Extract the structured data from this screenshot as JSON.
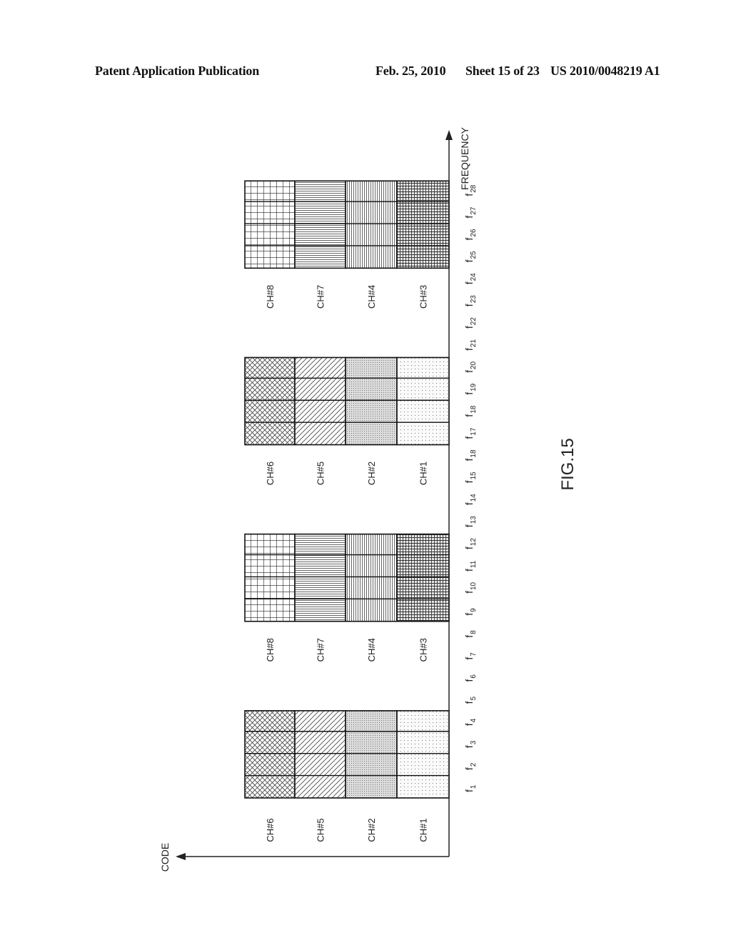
{
  "header": {
    "publication": "Patent Application Publication",
    "date": "Feb. 25, 2010",
    "sheet": "Sheet 15 of 23",
    "number": "US 2010/0048219 A1"
  },
  "figure": {
    "caption": "FIG.15",
    "axes": {
      "frequency_label": "FREQUENCY",
      "code_label": "CODE"
    },
    "frequency_labels": [
      {
        "main": "f",
        "sub": "1"
      },
      {
        "main": "f",
        "sub": "2"
      },
      {
        "main": "f",
        "sub": "3"
      },
      {
        "main": "f",
        "sub": "4"
      },
      {
        "main": "f",
        "sub": "5"
      },
      {
        "main": "f",
        "sub": "6"
      },
      {
        "main": "f",
        "sub": "7"
      },
      {
        "main": "f",
        "sub": "8"
      },
      {
        "main": "f",
        "sub": "9"
      },
      {
        "main": "f",
        "sub": "10"
      },
      {
        "main": "f",
        "sub": "11"
      },
      {
        "main": "f",
        "sub": "12"
      },
      {
        "main": "f",
        "sub": "13"
      },
      {
        "main": "f",
        "sub": "14"
      },
      {
        "main": "f",
        "sub": "15"
      },
      {
        "main": "f",
        "sub": "18"
      },
      {
        "main": "f",
        "sub": "17"
      },
      {
        "main": "f",
        "sub": "18"
      },
      {
        "main": "f",
        "sub": "19"
      },
      {
        "main": "f",
        "sub": "20"
      },
      {
        "main": "f",
        "sub": "21"
      },
      {
        "main": "f",
        "sub": "22"
      },
      {
        "main": "f",
        "sub": "23"
      },
      {
        "main": "f",
        "sub": "24"
      },
      {
        "main": "f",
        "sub": "25"
      },
      {
        "main": "f",
        "sub": "26"
      },
      {
        "main": "f",
        "sub": "27"
      },
      {
        "main": "f",
        "sub": "28"
      }
    ],
    "blocks": [
      {
        "freq_start": 1,
        "freq_end": 4,
        "channels": [
          {
            "label": "CH#6",
            "pattern": "crosshatch"
          },
          {
            "label": "CH#5",
            "pattern": "diagonal"
          },
          {
            "label": "CH#2",
            "pattern": "dense-dots"
          },
          {
            "label": "CH#1",
            "pattern": "sparse-dots"
          }
        ]
      },
      {
        "freq_start": 9,
        "freq_end": 12,
        "channels": [
          {
            "label": "CH#8",
            "pattern": "grid"
          },
          {
            "label": "CH#7",
            "pattern": "horizontal-lines"
          },
          {
            "label": "CH#4",
            "pattern": "vertical-lines"
          },
          {
            "label": "CH#3",
            "pattern": "fine-grid"
          }
        ]
      },
      {
        "freq_start": 17,
        "freq_end": 20,
        "channels": [
          {
            "label": "CH#6",
            "pattern": "crosshatch"
          },
          {
            "label": "CH#5",
            "pattern": "diagonal"
          },
          {
            "label": "CH#2",
            "pattern": "dense-dots"
          },
          {
            "label": "CH#1",
            "pattern": "sparse-dots"
          }
        ]
      },
      {
        "freq_start": 25,
        "freq_end": 28,
        "channels": [
          {
            "label": "CH#8",
            "pattern": "grid"
          },
          {
            "label": "CH#7",
            "pattern": "horizontal-lines"
          },
          {
            "label": "CH#4",
            "pattern": "vertical-lines"
          },
          {
            "label": "CH#3",
            "pattern": "fine-grid"
          }
        ]
      }
    ]
  }
}
